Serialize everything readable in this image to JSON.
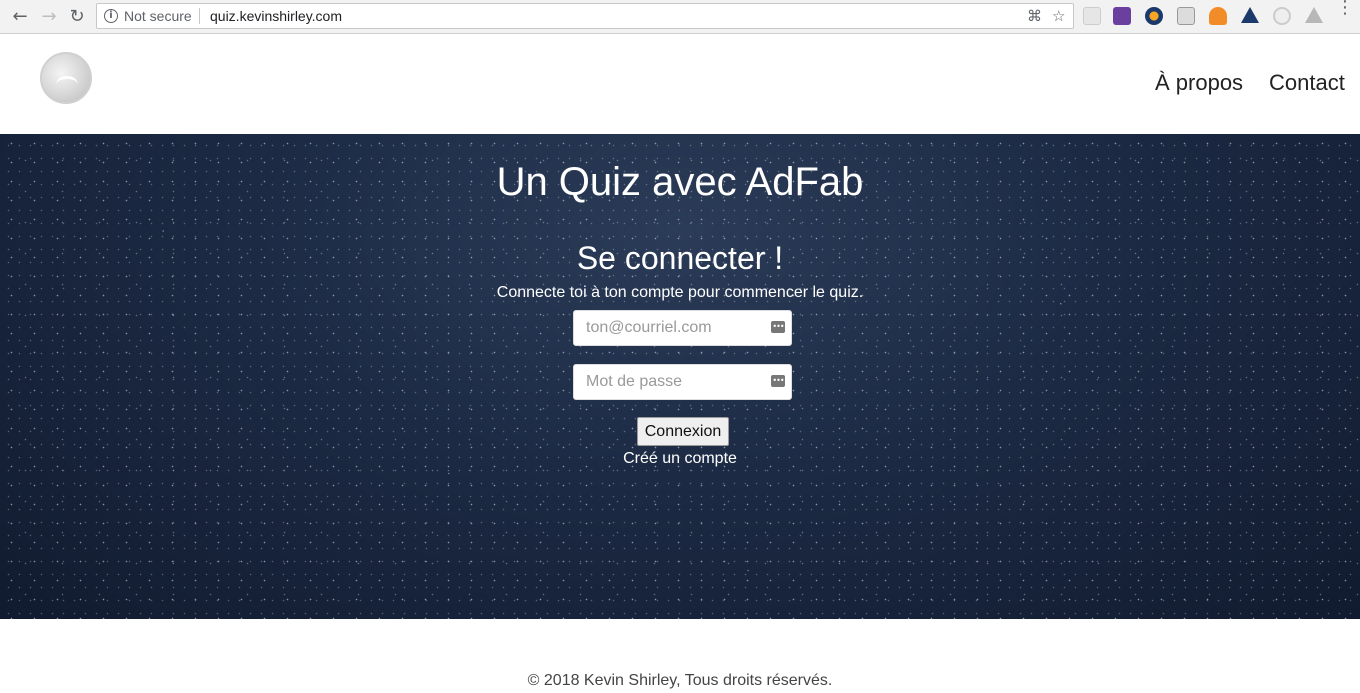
{
  "browser": {
    "security_label": "Not secure",
    "url": "quiz.kevinshirley.com",
    "back_icon": "arrow-left",
    "forward_icon": "arrow-right",
    "reload_icon": "reload",
    "info_icon": "info",
    "translate_icon": "translate",
    "bookmark_icon": "star",
    "menu_icon": "vertical-dots"
  },
  "header": {
    "nav": [
      {
        "label": "À propos"
      },
      {
        "label": "Contact"
      }
    ]
  },
  "hero": {
    "title": "Un Quiz avec AdFab",
    "login_title": "Se connecter !",
    "login_subtitle": "Connecte toi à ton compte pour commencer le quiz.",
    "email_placeholder": "ton@courriel.com",
    "password_placeholder": "Mot de passe",
    "submit_label": "Connexion",
    "signup_link": "Créé un compte"
  },
  "footer": {
    "copyright": "© 2018 Kevin Shirley, Tous droits réservés."
  },
  "colors": {
    "hero_background": "#1c2a44",
    "text_light": "#ffffff",
    "footer_text": "#444444"
  }
}
